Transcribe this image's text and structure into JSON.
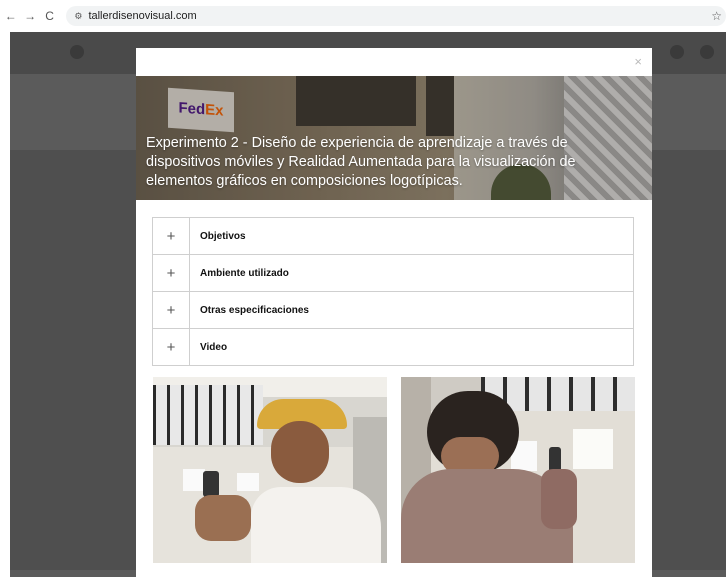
{
  "browser": {
    "back_icon": "←",
    "forward_icon": "→",
    "reload_icon": "C",
    "site_icon": "tune-icon",
    "url": "tallerdisenovisual.com",
    "star_icon": "☆"
  },
  "modal": {
    "close_label": "×",
    "title": "Experimento 2 - Diseño de experiencia de aprendizaje a través de dispositivos móviles y Realidad Aumentada para la visualización de elementos gráficos en composiciones logotípicas.",
    "hero_logo_text_1": "Fed",
    "hero_logo_text_2": "Ex",
    "accordion": [
      {
        "icon": "+",
        "label": "Objetivos"
      },
      {
        "icon": "+",
        "label": "Ambiente utilizado"
      },
      {
        "icon": "+",
        "label": "Otras especificaciones"
      },
      {
        "icon": "+",
        "label": "Video"
      }
    ]
  },
  "colors": {
    "overlay": "#5b5b5b",
    "modal_bg": "#ffffff",
    "border": "#cfcfcf"
  }
}
